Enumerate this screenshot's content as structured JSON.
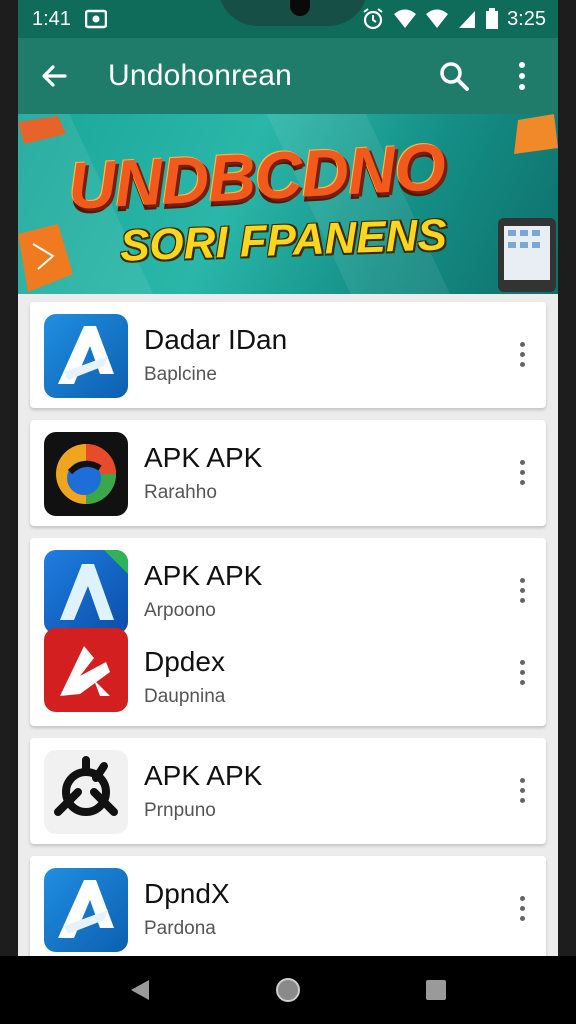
{
  "status_bar": {
    "time": "1:41",
    "clock": "3:25",
    "icons": [
      "image-icon",
      "alarm-icon",
      "wifi-icon",
      "signal-icon",
      "battery-icon"
    ]
  },
  "app_bar": {
    "title": "Undohonrean",
    "icons": [
      "back-arrow-icon",
      "search-icon",
      "overflow-menu-icon"
    ]
  },
  "banner": {
    "title": "UNDBCDNO",
    "subtitle": "SORI FPANENS"
  },
  "apps": [
    {
      "name": "Dadar IDan",
      "subtitle": "Baplcine",
      "icon": "arrow-a-blue-icon"
    },
    {
      "name": "APK APK",
      "subtitle": "Rarahho",
      "icon": "circle-swirl-icon"
    },
    {
      "name": "APK APK",
      "subtitle": "Arpoono",
      "icon": "arrow-a-blue-icon"
    },
    {
      "name": "Dpdex",
      "subtitle": "Daupnina",
      "icon": "red-arrow-icon"
    },
    {
      "name": "APK APK",
      "subtitle": "Prnpuno",
      "icon": "black-emblem-icon"
    },
    {
      "name": "DpndX",
      "subtitle": "Pardona",
      "icon": "arrow-a-blue-icon"
    }
  ],
  "nav_bar": {
    "icons": [
      "back-triangle-icon",
      "home-circle-icon",
      "recents-square-icon"
    ]
  },
  "colors": {
    "app_bar": "#1f7c6b",
    "status_bar": "#0f6b5a",
    "banner_title": "#f25a1c",
    "banner_subtitle": "#ffd61e"
  }
}
